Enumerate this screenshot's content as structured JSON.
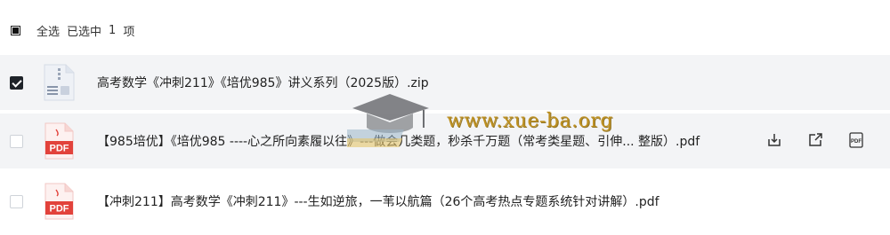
{
  "header": {
    "select_all_label": "全选",
    "selected_prefix": "已选中",
    "selected_count": "1",
    "selected_suffix": "项"
  },
  "files": [
    {
      "name": "高考数学《冲刺211》《培优985》讲义系列（2025版）.zip",
      "type": "zip",
      "checked": true
    },
    {
      "name": "【985培优】《培优985 ----心之所向素履以往》---做会几类题，秒杀千万题（常考类星题、引伸... 整版）.pdf",
      "type": "pdf",
      "checked": false,
      "icon_label": "PDF"
    },
    {
      "name": "【冲刺211】高考数学《冲刺211》---生如逆旅，一苇以航篇（26个高考热点专题系统针对讲解）.pdf",
      "type": "pdf",
      "checked": false,
      "icon_label": "PDF"
    }
  ],
  "actions": {
    "download_icon": "download-icon",
    "share_icon": "share-icon",
    "pdf_icon": "pdf-preview-icon"
  },
  "watermark": {
    "text": "www.xue-ba.org"
  },
  "colors": {
    "pdf_red": "#e2423b",
    "row_bg": "#f3f4f6",
    "watermark": "#b8860b"
  }
}
